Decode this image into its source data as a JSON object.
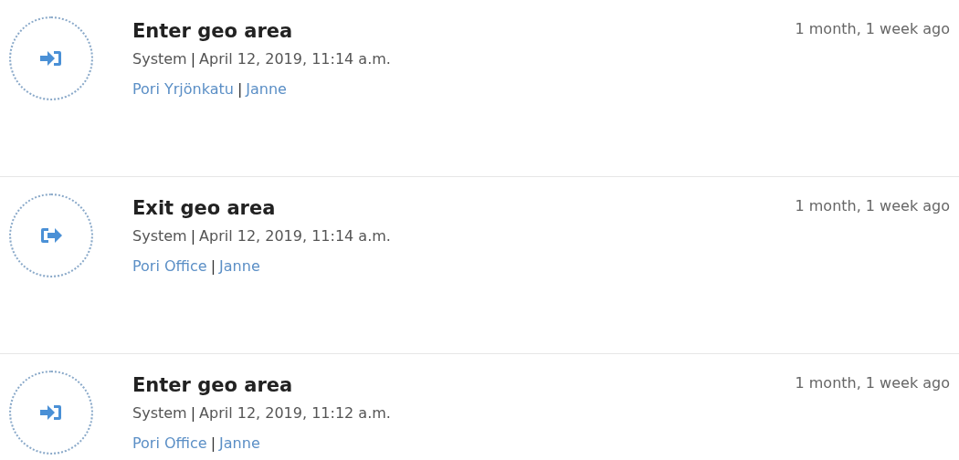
{
  "events": [
    {
      "kind": "enter",
      "title": "Enter geo area",
      "source": "System",
      "source_sep": "|",
      "date": "April 12, 2019, 11:14 a.m.",
      "place": "Pori Yrjönkatu",
      "link_sep": "|",
      "user": "Janne",
      "time": "1 month, 1 week ago"
    },
    {
      "kind": "exit",
      "title": "Exit geo area",
      "source": "System",
      "source_sep": "|",
      "date": "April 12, 2019, 11:14 a.m.",
      "place": "Pori Office",
      "link_sep": "|",
      "user": "Janne",
      "time": "1 month, 1 week ago"
    },
    {
      "kind": "enter",
      "title": "Enter geo area",
      "source": "System",
      "source_sep": "|",
      "date": "April 12, 2019, 11:12 a.m.",
      "place": "Pori Office",
      "link_sep": "|",
      "user": "Janne",
      "time": "1 month, 1 week ago"
    }
  ]
}
